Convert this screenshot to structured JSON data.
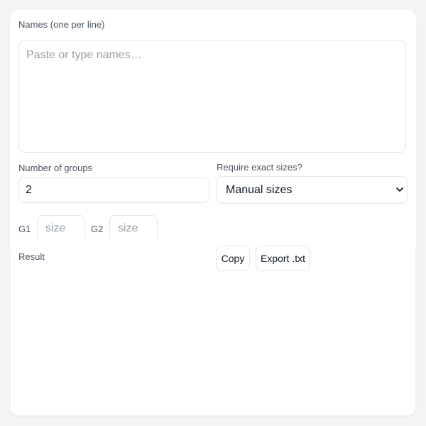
{
  "form": {
    "names_label": "Names (one per line)",
    "names_placeholder": "Paste or type names…",
    "groups_label": "Number of groups",
    "groups_value": "2",
    "exact_label": "Require exact sizes?",
    "exact_selected": "Manual sizes",
    "groups": [
      {
        "label": "G1",
        "size_placeholder": "size"
      },
      {
        "label": "G2",
        "size_placeholder": "size"
      }
    ]
  },
  "result": {
    "label": "Result",
    "copy_label": "Copy",
    "export_label": "Export .txt"
  },
  "icons": {
    "select_arrow": "chevron-down-icon"
  },
  "colors": {
    "background": "#f3f4f6",
    "card": "#ffffff",
    "border": "#e2e5ea",
    "label_text": "#4b5563",
    "placeholder_text": "#9aa0a8"
  }
}
